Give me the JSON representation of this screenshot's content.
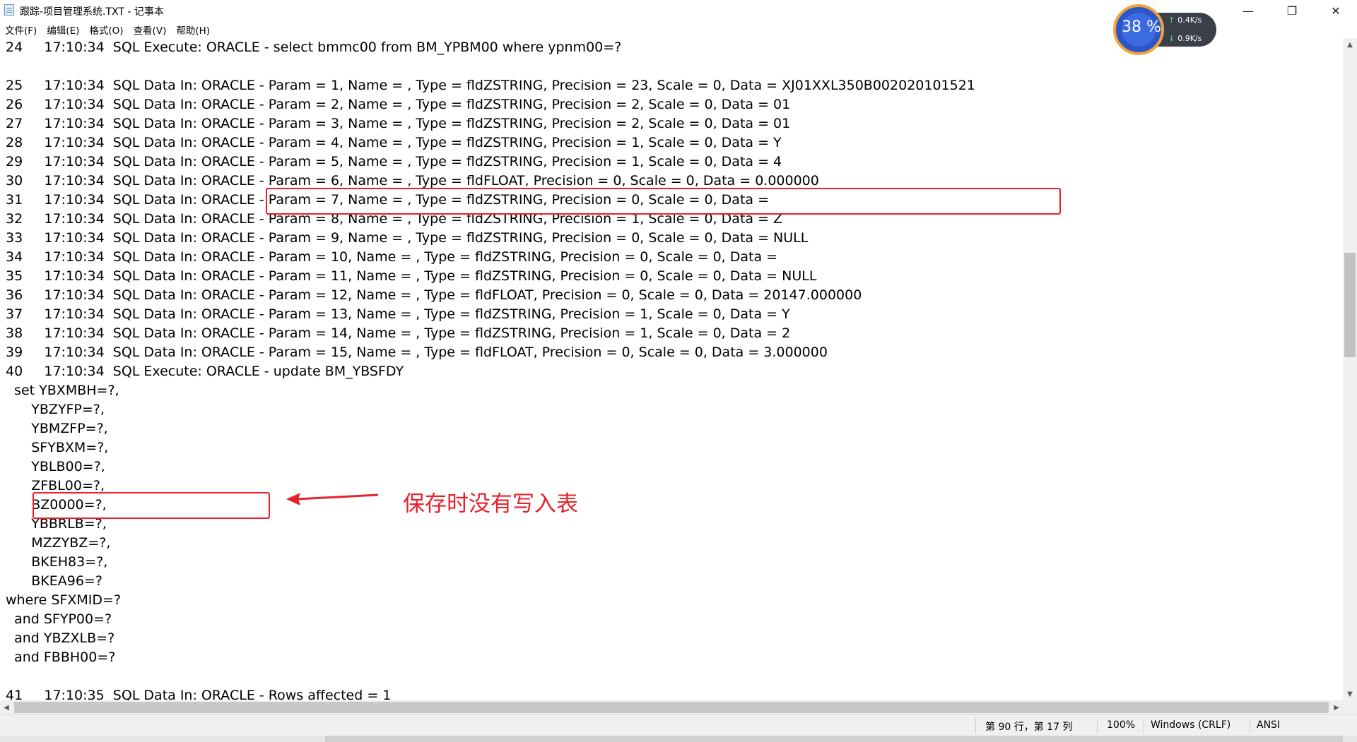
{
  "window": {
    "title": "跟踪-项目管理系统.TXT - 记事本",
    "minimize_glyph": "—",
    "maximize_glyph": "❐",
    "close_glyph": "✕"
  },
  "menu": [
    "文件(F)",
    "编辑(E)",
    "格式(O)",
    "查看(V)",
    "帮助(H)"
  ],
  "lines": [
    {
      "text": "24     17:10:34  SQL Execute: ORACLE - select bmmc00 from BM_YPBM00 where ypnm00=?"
    },
    {
      "text": ""
    },
    {
      "text": "25     17:10:34  SQL Data In: ORACLE - Param = 1, Name = , Type = fldZSTRING, Precision = 23, Scale = 0, Data = XJ01XXL350B002020101521"
    },
    {
      "text": "26     17:10:34  SQL Data In: ORACLE - Param = 2, Name = , Type = fldZSTRING, Precision = 2, Scale = 0, Data = 01"
    },
    {
      "text": "27     17:10:34  SQL Data In: ORACLE - Param = 3, Name = , Type = fldZSTRING, Precision = 2, Scale = 0, Data = 01"
    },
    {
      "text": "28     17:10:34  SQL Data In: ORACLE - Param = 4, Name = , Type = fldZSTRING, Precision = 1, Scale = 0, Data = Y"
    },
    {
      "text": "29     17:10:34  SQL Data In: ORACLE - Param = 5, Name = , Type = fldZSTRING, Precision = 1, Scale = 0, Data = 4"
    },
    {
      "text": "30     17:10:34  SQL Data In: ORACLE - Param = 6, Name = , Type = fldFLOAT, Precision = 0, Scale = 0, Data = 0.000000"
    },
    {
      "text": "31     17:10:34  SQL Data In: ORACLE - Param = 7, Name = , Type = fldZSTRING, Precision = 0, Scale = 0, Data ="
    },
    {
      "text": "32     17:10:34  SQL Data In: ORACLE - Param = 8, Name = , Type = fldZSTRING, Precision = 1, Scale = 0, Data = Z"
    },
    {
      "text": "33     17:10:34  SQL Data In: ORACLE - Param = 9, Name = , Type = fldZSTRING, Precision = 0, Scale = 0, Data = NULL"
    },
    {
      "text": "34     17:10:34  SQL Data In: ORACLE - Param = 10, Name = , Type = fldZSTRING, Precision = 0, Scale = 0, Data ="
    },
    {
      "text": "35     17:10:34  SQL Data In: ORACLE - Param = 11, Name = , Type = fldZSTRING, Precision = 0, Scale = 0, Data = NULL"
    },
    {
      "text": "36     17:10:34  SQL Data In: ORACLE - Param = 12, Name = , Type = fldFLOAT, Precision = 0, Scale = 0, Data = 20147.000000"
    },
    {
      "text": "37     17:10:34  SQL Data In: ORACLE - Param = 13, Name = , Type = fldZSTRING, Precision = 1, Scale = 0, Data = Y"
    },
    {
      "text": "38     17:10:34  SQL Data In: ORACLE - Param = 14, Name = , Type = fldZSTRING, Precision = 1, Scale = 0, Data = 2"
    },
    {
      "text": "39     17:10:34  SQL Data In: ORACLE - Param = 15, Name = , Type = fldFLOAT, Precision = 0, Scale = 0, Data = 3.000000"
    },
    {
      "text": "40     17:10:34  SQL Execute: ORACLE - update BM_YBSFDY"
    },
    {
      "text": "  set YBXMBH=?,"
    },
    {
      "text": "      YBZYFP=?,"
    },
    {
      "text": "      YBMZFP=?,"
    },
    {
      "text": "      SFYBXM=?,"
    },
    {
      "text": "      YBLB00=?,"
    },
    {
      "text": "      ZFBL00=?,"
    },
    {
      "text": "      BZ0000=?,"
    },
    {
      "text": "      YBBRLB=?,"
    },
    {
      "text": "      MZZYBZ=?,"
    },
    {
      "text": "      BKEH83=?,"
    },
    {
      "text": "      BKEA96=?"
    },
    {
      "text": "where SFXMID=?"
    },
    {
      "text": "  and SFYP00=?"
    },
    {
      "text": "  and YBZXLB=?"
    },
    {
      "text": "  and FBBH00=?"
    },
    {
      "text": ""
    },
    {
      "text": "41     17:10:35  SQL Data In: ORACLE - Rows affected = 1"
    }
  ],
  "annotation": {
    "note": "保存时没有写入表",
    "color": "#e8212b"
  },
  "widget": {
    "cpu_percent": "38 %",
    "upload": "0.4K/s",
    "download": "0.9K/s"
  },
  "scrollbar": {
    "up_glyph": "▲",
    "down_glyph": "▼",
    "left_glyph": "◀",
    "right_glyph": "▶"
  },
  "status": {
    "position": "第 90 行，第 17 列",
    "zoom": "100%",
    "line_ending": "Windows (CRLF)",
    "encoding": "ANSI"
  }
}
